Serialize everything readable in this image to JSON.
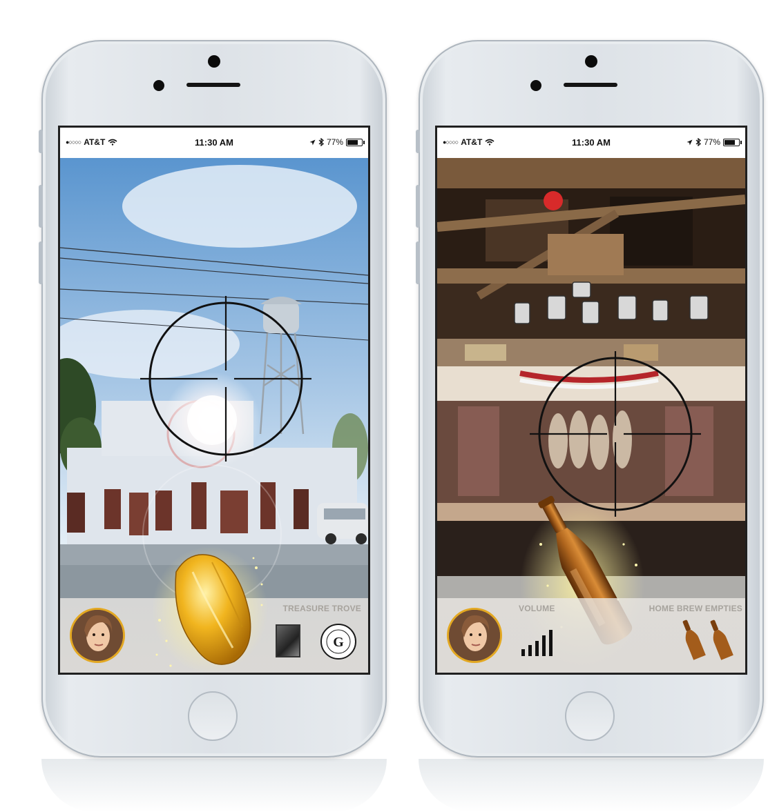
{
  "phones": [
    {
      "status": {
        "signal_dots": "●○○○○",
        "carrier": "AT&T",
        "wifi_icon": "wifi-icon",
        "time": "11:30 AM",
        "battery_text": "77%",
        "battery_level": 0.77
      },
      "hud": {
        "right_label": "TREASURE TROVE"
      }
    },
    {
      "status": {
        "signal_dots": "●○○○○",
        "carrier": "AT&T",
        "wifi_icon": "wifi-icon",
        "time": "11:30 AM",
        "battery_text": "77%",
        "battery_level": 0.77
      },
      "hud": {
        "volume_label": "VOLUME",
        "right_label": "HOME BREW EMPTIES"
      }
    }
  ],
  "colors": {
    "avatar_ring": "#e3a822",
    "hud_text": "#a7a39d",
    "gold": "#e6a917",
    "bottle": "#8a4b14"
  }
}
